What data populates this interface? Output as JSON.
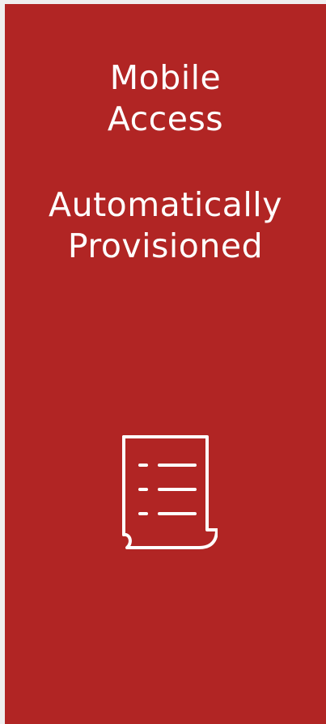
{
  "card": {
    "heading_line1": "Mobile",
    "heading_line2": "Access",
    "subheading_line1": "Automatically",
    "subheading_line2": "Provisioned",
    "background_color": "#b12524",
    "text_color": "#ffffff",
    "icon": "document-list-icon"
  }
}
